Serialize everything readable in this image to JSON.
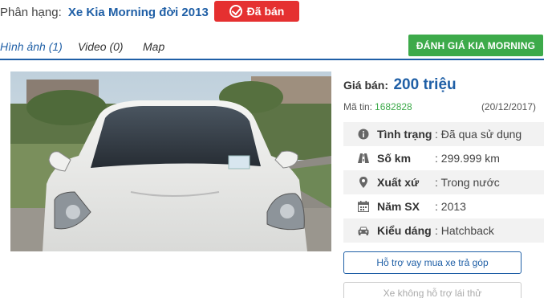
{
  "header": {
    "category_prefix": "Phân hạng:",
    "category_name": "Xe Kia Morning đời 2013",
    "status_badge": "Đã bán"
  },
  "tabs": [
    {
      "label": "Hình ảnh (1)",
      "active": true
    },
    {
      "label": "Video (0)",
      "active": false
    },
    {
      "label": "Map",
      "active": false
    }
  ],
  "evaluate_button": "ĐÁNH GIÁ KIA MORNING",
  "listing": {
    "price_label": "Giá bán:",
    "price_value": "200 triệu",
    "code_label": "Mã tin:",
    "code_value": "1682828",
    "date": "(20/12/2017)"
  },
  "specs": [
    {
      "icon": "info-icon",
      "label": "Tình trạng",
      "value": ": Đã qua sử dụng"
    },
    {
      "icon": "road-icon",
      "label": "Số km",
      "value": ": 299.999 km"
    },
    {
      "icon": "map-pin-icon",
      "label": "Xuất xứ",
      "value": ": Trong nước"
    },
    {
      "icon": "calendar-icon",
      "label": "Năm SX",
      "value": ": 2013"
    },
    {
      "icon": "car-icon",
      "label": "Kiểu dáng",
      "value": ": Hatchback"
    }
  ],
  "actions": {
    "loan_button": "Hỗ trợ vay mua xe trả góp",
    "test_drive_button": "Xe không hỗ trợ lái thử"
  },
  "colors": {
    "brand_blue": "#1f5fa6",
    "sold_red": "#e53030",
    "green": "#3daa4a"
  }
}
